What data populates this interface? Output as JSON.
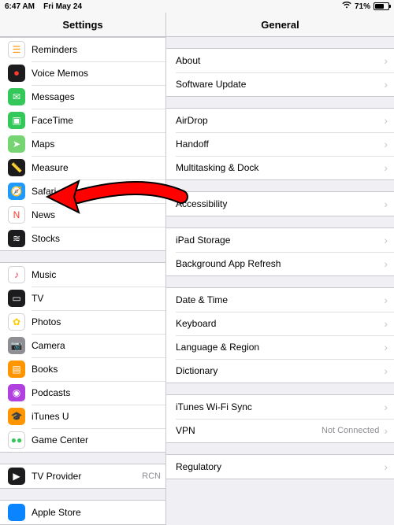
{
  "status": {
    "time": "6:47 AM",
    "date": "Fri May 24",
    "wifi_icon": "wifi",
    "battery_pct": "71%",
    "battery_fill_pct": 71
  },
  "nav": {
    "left_title": "Settings",
    "right_title": "General"
  },
  "sidebar": {
    "groups": [
      {
        "items": [
          {
            "label": "Reminders",
            "icon": "reminders",
            "bg": "#ffffff",
            "fg": "#ff9500",
            "border": true
          },
          {
            "label": "Voice Memos",
            "icon": "voice",
            "bg": "#1c1c1e",
            "fg": "#ff3b30"
          },
          {
            "label": "Messages",
            "icon": "messages",
            "bg": "#34c759",
            "fg": "#fff"
          },
          {
            "label": "FaceTime",
            "icon": "facetime",
            "bg": "#34c759",
            "fg": "#fff"
          },
          {
            "label": "Maps",
            "icon": "maps",
            "bg": "#76d572",
            "fg": "#fff"
          },
          {
            "label": "Measure",
            "icon": "measure",
            "bg": "#1c1c1e",
            "fg": "#ffcc00"
          },
          {
            "label": "Safari",
            "icon": "safari",
            "bg": "#1f9bff",
            "fg": "#fff"
          },
          {
            "label": "News",
            "icon": "news",
            "bg": "#ffffff",
            "fg": "#ff3b30",
            "border": true
          },
          {
            "label": "Stocks",
            "icon": "stocks",
            "bg": "#1c1c1e",
            "fg": "#fff"
          }
        ]
      },
      {
        "items": [
          {
            "label": "Music",
            "icon": "music",
            "bg": "#ffffff",
            "fg": "#ff2d55",
            "border": true
          },
          {
            "label": "TV",
            "icon": "tv",
            "bg": "#1c1c1e",
            "fg": "#fff"
          },
          {
            "label": "Photos",
            "icon": "photos",
            "bg": "#ffffff",
            "fg": "#ffcc00",
            "border": true
          },
          {
            "label": "Camera",
            "icon": "camera",
            "bg": "#8e8e93",
            "fg": "#fff"
          },
          {
            "label": "Books",
            "icon": "books",
            "bg": "#ff9500",
            "fg": "#fff"
          },
          {
            "label": "Podcasts",
            "icon": "podcasts",
            "bg": "#b041de",
            "fg": "#fff"
          },
          {
            "label": "iTunes U",
            "icon": "itunesu",
            "bg": "#ff9500",
            "fg": "#fff"
          },
          {
            "label": "Game Center",
            "icon": "gamecenter",
            "bg": "#ffffff",
            "fg": "#34c759",
            "border": true
          }
        ]
      },
      {
        "items": [
          {
            "label": "TV Provider",
            "icon": "tvprovider",
            "bg": "#1c1c1e",
            "fg": "#fff",
            "value": "RCN"
          }
        ]
      },
      {
        "items": [
          {
            "label": "Apple Store",
            "icon": "applestore",
            "bg": "#0a84ff",
            "fg": "#fff"
          }
        ]
      }
    ]
  },
  "detail": {
    "groups": [
      {
        "items": [
          {
            "label": "About"
          },
          {
            "label": "Software Update"
          }
        ]
      },
      {
        "items": [
          {
            "label": "AirDrop"
          },
          {
            "label": "Handoff"
          },
          {
            "label": "Multitasking & Dock"
          }
        ]
      },
      {
        "items": [
          {
            "label": "Accessibility"
          }
        ]
      },
      {
        "items": [
          {
            "label": "iPad Storage"
          },
          {
            "label": "Background App Refresh"
          }
        ]
      },
      {
        "items": [
          {
            "label": "Date & Time"
          },
          {
            "label": "Keyboard"
          },
          {
            "label": "Language & Region"
          },
          {
            "label": "Dictionary"
          }
        ]
      },
      {
        "items": [
          {
            "label": "iTunes Wi-Fi Sync"
          },
          {
            "label": "VPN",
            "value": "Not Connected"
          }
        ]
      },
      {
        "items": [
          {
            "label": "Regulatory"
          }
        ]
      }
    ]
  },
  "annotation": {
    "arrow_target_label": "Safari"
  }
}
